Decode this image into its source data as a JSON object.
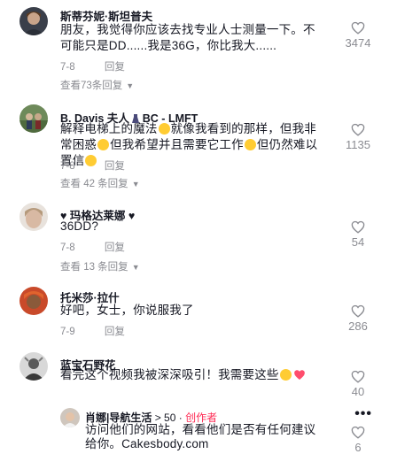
{
  "comments": [
    {
      "name": "斯蒂芬妮·斯坦普夫",
      "text": "朋友，我觉得你应该去找专业人士测量一下。不可能只是DD......我是36G，你比我大......",
      "date": "7-8",
      "reply": "回复",
      "likes": "3474",
      "view_replies": "查看73条回复"
    },
    {
      "name": "B. Davis 夫人",
      "name_suffix": "BC - LMFT",
      "text_parts": [
        "解释电梯上的魔法",
        "就像我看到的那样，但我非常困惑",
        "但我希望并且需要它工作",
        "但仍然难以置信"
      ],
      "date": "7-8",
      "reply": "回复",
      "likes": "1135",
      "view_replies": "查看 42 条回复"
    },
    {
      "name": "玛格达莱娜",
      "text": "36DD?",
      "date": "7-8",
      "reply": "回复",
      "likes": "54",
      "view_replies": "查看 13 条回复"
    },
    {
      "name": "托米莎·拉什",
      "text": "好吧，女士，你说服我了",
      "date": "7-9",
      "reply": "回复",
      "likes": "286"
    },
    {
      "name": "蓝宝石野花",
      "text": "看完这个视频我被深深吸引！我需要这些",
      "likes": "40"
    }
  ],
  "creator_reply": {
    "name": "肖娜|导航生活",
    "follower_hint": "> 50 ·",
    "badge": "创作者",
    "text": "访问他们的网站，看看他们是否有任何建议给你。Cakesbody.com",
    "likes": "6",
    "more": "•••"
  },
  "colors": {
    "accent": "#fe2c55",
    "muted": "#8a8b91",
    "text": "#161823"
  },
  "icons": [
    "heart-outline-icon",
    "chevron-down-icon",
    "more-dots-icon"
  ]
}
